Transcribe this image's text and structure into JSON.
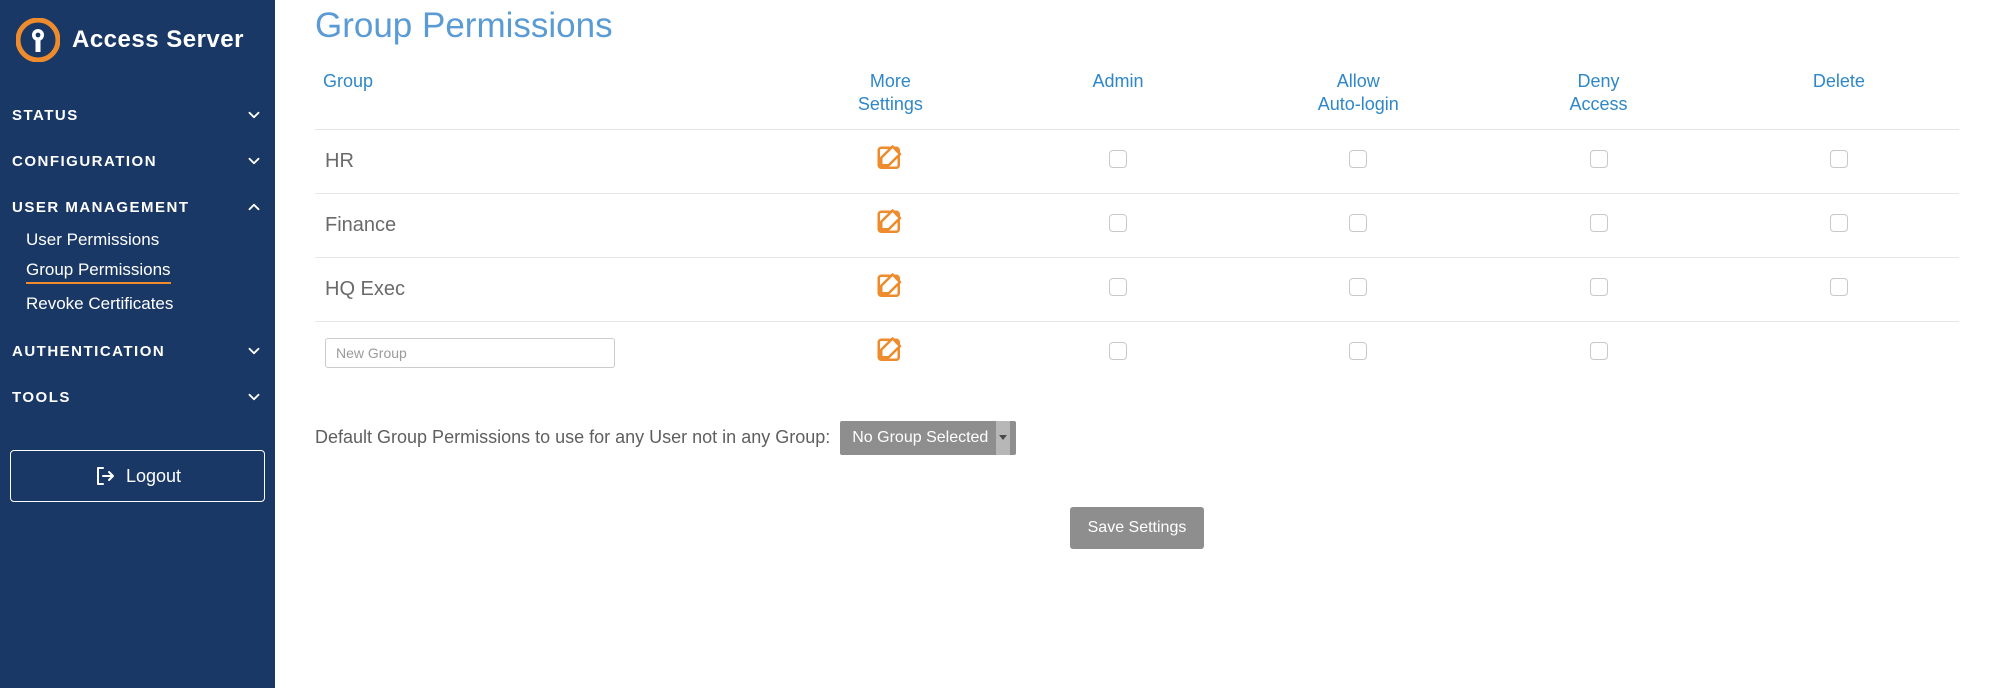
{
  "brand": {
    "title": "Access Server"
  },
  "sidebar": {
    "sections": [
      {
        "label": "STATUS",
        "expanded": false
      },
      {
        "label": "CONFIGURATION",
        "expanded": false
      },
      {
        "label": "USER MANAGEMENT",
        "expanded": true,
        "items": [
          {
            "label": "User Permissions",
            "active": false
          },
          {
            "label": "Group Permissions",
            "active": true
          },
          {
            "label": "Revoke Certificates",
            "active": false
          }
        ]
      },
      {
        "label": "AUTHENTICATION",
        "expanded": false
      },
      {
        "label": "TOOLS",
        "expanded": false
      }
    ],
    "logout_label": "Logout"
  },
  "page": {
    "title": "Group Permissions",
    "columns": {
      "group": "Group",
      "more_settings": "More Settings",
      "admin": "Admin",
      "allow_auto_login": "Allow Auto-login",
      "deny_access": "Deny Access",
      "delete": "Delete"
    },
    "rows": [
      {
        "name": "HR"
      },
      {
        "name": "Finance"
      },
      {
        "name": "HQ Exec"
      }
    ],
    "new_group_placeholder": "New Group",
    "default_label": "Default Group Permissions to use for any User not in any Group:",
    "default_selected": "No Group Selected",
    "save_label": "Save Settings"
  }
}
